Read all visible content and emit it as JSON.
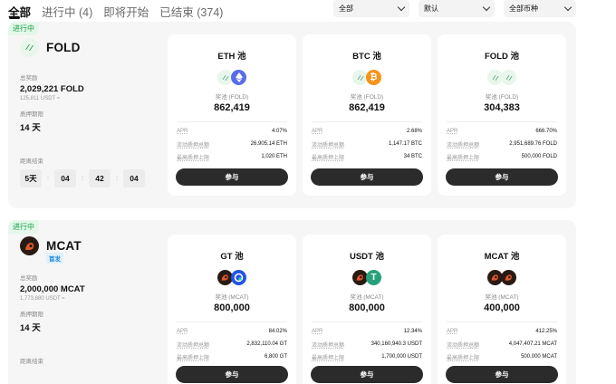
{
  "tabs": [
    {
      "label": "全部"
    },
    {
      "label": "进行中 (4)"
    },
    {
      "label": "即将开始"
    },
    {
      "label": "已结束 (374)"
    }
  ],
  "filters": {
    "status": "全部",
    "sort": "默认",
    "currency": "全部币种"
  },
  "projects": [
    {
      "status": "进行中",
      "name": "FOLD",
      "total_reward_label": "总奖励",
      "total_reward": "2,029,221 FOLD",
      "total_reward_usdt": "125,811 USDT ≈",
      "period_label": "质押期限",
      "period": "14 天",
      "countdown_label": "距离结束",
      "countdown": [
        "5天",
        "04",
        "42",
        "04"
      ],
      "pools": [
        {
          "title": "ETH 池",
          "reward_label": "奖池 (FOLD)",
          "reward": "862,419",
          "apr_label": "APR",
          "apr": "4.07%",
          "liquid_label": "流动质押总额",
          "liquid": "26,905.14 ETH",
          "max_label": "最高质押上限",
          "max": "1,020 ETH",
          "join": "参与"
        },
        {
          "title": "BTC 池",
          "reward_label": "奖池 (FOLD)",
          "reward": "862,419",
          "apr_label": "APR",
          "apr": "2.68%",
          "liquid_label": "流动质押总额",
          "liquid": "1,147.17 BTC",
          "max_label": "最高质押上限",
          "max": "34 BTC",
          "join": "参与"
        },
        {
          "title": "FOLD 池",
          "reward_label": "奖池 (FOLD)",
          "reward": "304,383",
          "apr_label": "APR",
          "apr": "666.70%",
          "liquid_label": "流动质押总额",
          "liquid": "2,951,689.76 FOLD",
          "max_label": "最高质押上限",
          "max": "500,000 FOLD",
          "join": "参与"
        }
      ]
    },
    {
      "status": "进行中",
      "name": "MCAT",
      "badge": "首发",
      "total_reward_label": "总奖励",
      "total_reward": "2,000,000 MCAT",
      "total_reward_usdt": "1,773,880 USDT ≈",
      "period_label": "质押期限",
      "period": "14 天",
      "countdown_label": "距离结束",
      "pools": [
        {
          "title": "GT 池",
          "reward_label": "奖池 (MCAT)",
          "reward": "800,000",
          "apr_label": "APR",
          "apr": "84.02%",
          "liquid_label": "流动质押总额",
          "liquid": "2,832,110.04 GT",
          "max_label": "最高质押上限",
          "max": "6,800 GT",
          "join": "参与"
        },
        {
          "title": "USDT 池",
          "reward_label": "奖池 (MCAT)",
          "reward": "800,000",
          "apr_label": "APR",
          "apr": "12.34%",
          "liquid_label": "流动质押总额",
          "liquid": "340,160,940.3 USDT",
          "max_label": "最高质押上限",
          "max": "1,700,000 USDT",
          "join": "参与"
        },
        {
          "title": "MCAT 池",
          "reward_label": "奖池 (MCAT)",
          "reward": "400,000",
          "apr_label": "APR",
          "apr": "412.25%",
          "liquid_label": "流动质押总额",
          "liquid": "4,047,407.21 MCAT",
          "max_label": "最高质押上限",
          "max": "500,000 MCAT",
          "join": "参与"
        }
      ]
    }
  ],
  "colors": {
    "accent_green": "#14a04a",
    "button_dark": "#2b2b2b",
    "panel_bg": "#f6f6f6"
  }
}
